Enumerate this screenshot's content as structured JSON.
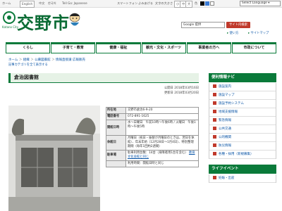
{
  "topbar": {
    "home": "ホーム",
    "lang_en": "English",
    "lang_zh": "中文",
    "lang_ko": "한국어",
    "lang_ja_easy": "Tell Go: Japanese",
    "mobile": "スマートフォン",
    "yomiage": "よみあげる",
    "font_size": "文字の大きさ",
    "font_small": "小",
    "font_mid": "中",
    "font_large": "大",
    "color": "色",
    "select_language": "Select Language ▾"
  },
  "header": {
    "city_name": "交野市",
    "city_roman": "Katano City",
    "links": "交野市の概要 ・ 組織から探す ・ お問い合わせ",
    "search_placeholder": "Google 提供",
    "search_button": "サイト内検索",
    "link_howto": "使い方",
    "link_sitemap": "サイトマップ"
  },
  "nav": {
    "tabs": [
      "くらし",
      "子育て・教育",
      "健康・福祉",
      "観光・文化・スポーツ",
      "事業者の方へ",
      "市政について"
    ]
  },
  "breadcrumb": {
    "items": [
      "ホーム",
      "組織",
      "公募図書館",
      "情報直接譲 広報販売"
    ],
    "show_all": "記事カテゴリを全て表示する"
  },
  "page": {
    "title": "倉治図書館",
    "published": "公開日 2018年03月16日",
    "updated": "更新日 2018年03月20日"
  },
  "info_table": [
    {
      "label": "所在地",
      "value": "交野市倉治6-9-20",
      "link": ""
    },
    {
      "label": "電話番号",
      "value": "072-891-1625",
      "link": ""
    },
    {
      "label": "開館日時",
      "value": "水～日曜日　午前10時～午後6時 / 火曜日　午後1時～午後5時",
      "link": ""
    },
    {
      "label": "休館日",
      "value": "月曜日（祝日・振替が月曜日のときは、翌日を休館）、年末年始（12月28日～1月4日）、特別整理期間（毎年1回約2週間）",
      "link": ""
    },
    {
      "label": "駐車場",
      "value": "駐車利用台数：14台（身障者用1台を含む）",
      "link": "教育文化会館と同じ"
    },
    {
      "label": "",
      "value": "利用時間：開館日時と同じ",
      "link": ""
    }
  ],
  "sidebar": {
    "nav_title": "便利情報ナビ",
    "nav_items": [
      "施設案内",
      "施設マップ",
      "施設予約システム",
      "地域支援情報",
      "緊急情報",
      "公共交通",
      "公的機関",
      "防災情報",
      "各種・採用（新規募集）"
    ],
    "life_title": "ライフイベント",
    "life_items": [
      "妊娠・出産"
    ]
  }
}
